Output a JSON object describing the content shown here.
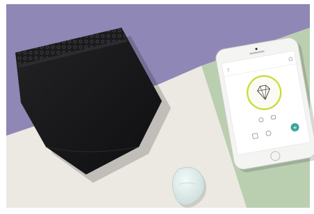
{
  "photo": {
    "subject": "product-flatlay",
    "colors": {
      "lavender": "#8f87b5",
      "cream": "#ece8e2",
      "mint": "#b9cfb0",
      "garment": "#1a1a1c",
      "phone_body": "#f4f4f2",
      "app_ring": "#c9dd3a",
      "app_fab": "#3aa69b",
      "sensor": "#dfeeec"
    }
  },
  "phone_screen": {
    "status_time": "",
    "dial_icon": "gem-icon"
  }
}
